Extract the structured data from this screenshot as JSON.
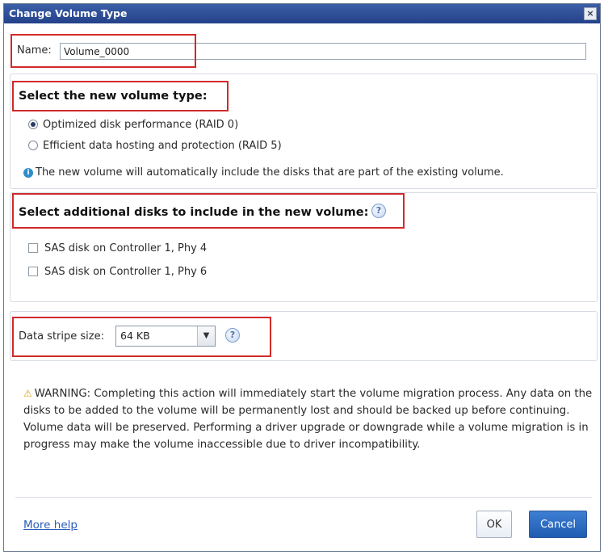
{
  "dialog": {
    "title": "Change Volume Type",
    "close_icon": "×"
  },
  "name_field": {
    "label": "Name:",
    "value": "Volume_0000"
  },
  "volume_type": {
    "heading": "Select the new volume type:",
    "options": [
      {
        "label": "Optimized disk performance (RAID 0)",
        "selected": true
      },
      {
        "label": "Efficient data hosting and protection (RAID 5)",
        "selected": false
      }
    ],
    "info_text": "The new volume will automatically include the disks that are part of the existing volume."
  },
  "additional_disks": {
    "heading": "Select additional disks to include in the new volume:",
    "disks": [
      {
        "label": "SAS disk on Controller 1, Phy 4",
        "checked": false
      },
      {
        "label": "SAS disk on Controller 1, Phy 6",
        "checked": false
      }
    ]
  },
  "stripe": {
    "label": "Data stripe size:",
    "value": "64 KB"
  },
  "warning": {
    "text": "WARNING: Completing this action will immediately start the volume migration process. Any data on the disks to be added to the volume will be permanently lost and should be backed up before continuing. Volume data will be preserved. Performing a driver upgrade or downgrade while a volume migration is in progress may make the volume inaccessible due to driver incompatibility."
  },
  "footer": {
    "more_help": "More help",
    "ok": "OK",
    "cancel": "Cancel"
  },
  "icons": {
    "help": "?",
    "info": "i",
    "warning": "⚠",
    "dropdown": "▼"
  },
  "colors": {
    "title_bar": "#2c4c96",
    "highlight_box": "#d12a2a",
    "link": "#2a5db8",
    "cancel_button": "#1f5cb3"
  }
}
